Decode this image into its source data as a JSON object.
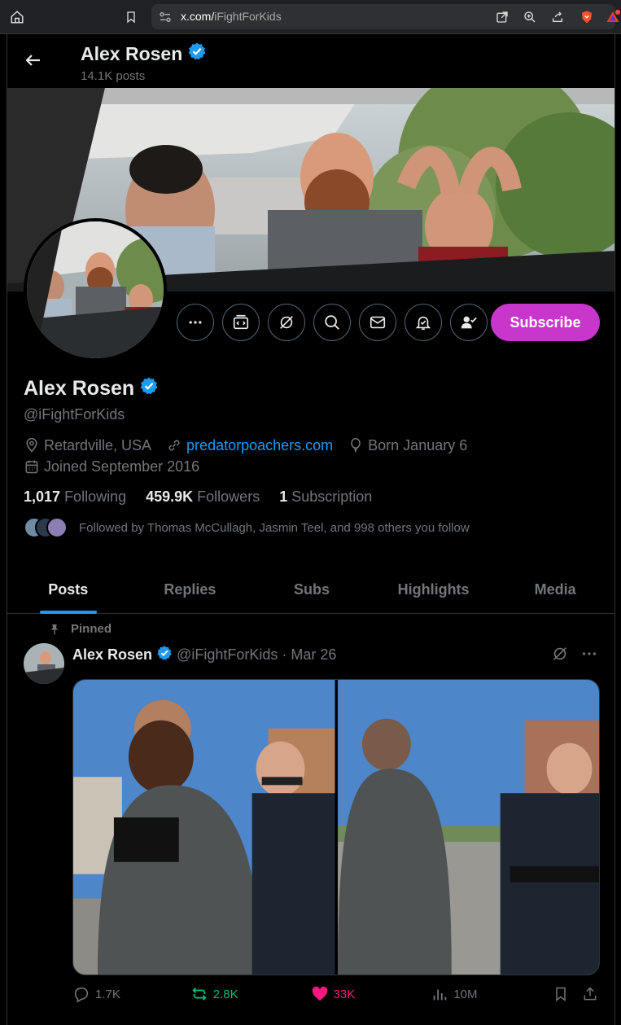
{
  "browser": {
    "url_domain": "x.com/",
    "url_path": "iFightForKids"
  },
  "header": {
    "name": "Alex Rosen",
    "posts": "14.1K posts"
  },
  "profile": {
    "name": "Alex Rosen",
    "handle": "@iFightForKids",
    "location": "Retardville, USA",
    "website": "predatorpoachers.com",
    "birthday": "Born January 6",
    "joined": "Joined September 2016",
    "subscribe_label": "Subscribe",
    "following_count": "1,017",
    "following_label": "Following",
    "followers_count": "459.9K",
    "followers_label": "Followers",
    "subscriptions_count": "1",
    "subscriptions_label": "Subscription",
    "followed_by": "Followed by Thomas McCullagh, Jasmin Teel, and 998 others you follow"
  },
  "tabs": [
    {
      "label": "Posts"
    },
    {
      "label": "Replies"
    },
    {
      "label": "Subs"
    },
    {
      "label": "Highlights"
    },
    {
      "label": "Media"
    }
  ],
  "post": {
    "pinned_label": "Pinned",
    "author": "Alex Rosen",
    "handle": "@iFightForKids",
    "dot": "·",
    "date": "Mar 26",
    "replies": "1.7K",
    "reposts": "2.8K",
    "likes": "33K",
    "views": "10M"
  },
  "colors": {
    "accent": "#1d9bf0",
    "subscribe": "#c936cc",
    "repost_green": "#00ba7c",
    "like_pink": "#f91880"
  }
}
